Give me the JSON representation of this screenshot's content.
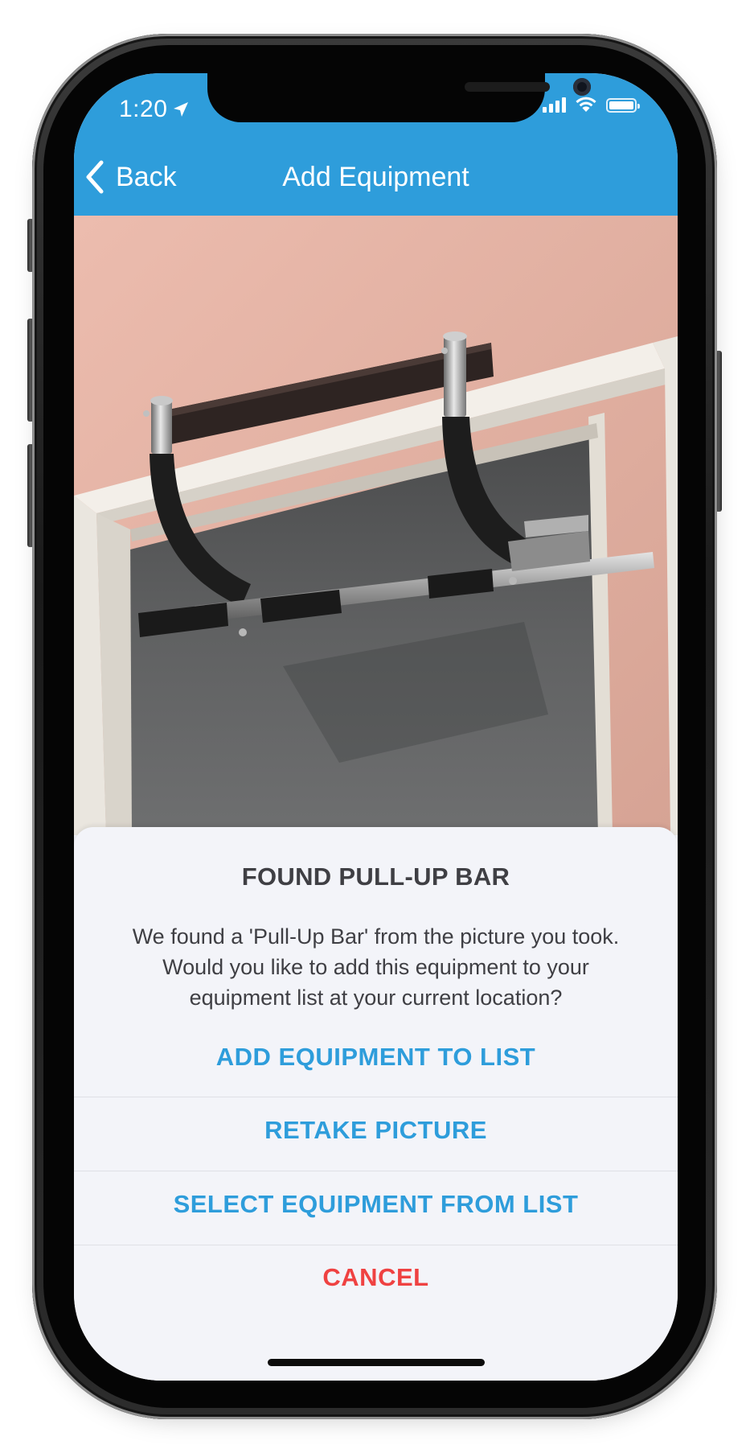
{
  "status_bar": {
    "time": "1:20",
    "icons": [
      "location-arrow-icon",
      "cellular-signal-icon",
      "wifi-icon",
      "battery-icon"
    ]
  },
  "nav": {
    "back_label": "Back",
    "title": "Add Equipment",
    "background": "#2e9ddb"
  },
  "photo": {
    "subject": "pull-up bar mounted in a doorway"
  },
  "sheet": {
    "title": "FOUND PULL-UP BAR",
    "message_line1": "We found a 'Pull-Up Bar' from the picture you took.",
    "message_line2": "Would you like to add this equipment to your",
    "message_line3": "equipment list at your current location?",
    "actions": [
      {
        "label": "ADD EQUIPMENT TO LIST",
        "color": "#2e9ddb"
      },
      {
        "label": "RETAKE PICTURE",
        "color": "#2e9ddb"
      },
      {
        "label": "SELECT EQUIPMENT FROM LIST",
        "color": "#2e9ddb"
      },
      {
        "label": "CANCEL",
        "color": "#ef4242"
      }
    ]
  }
}
